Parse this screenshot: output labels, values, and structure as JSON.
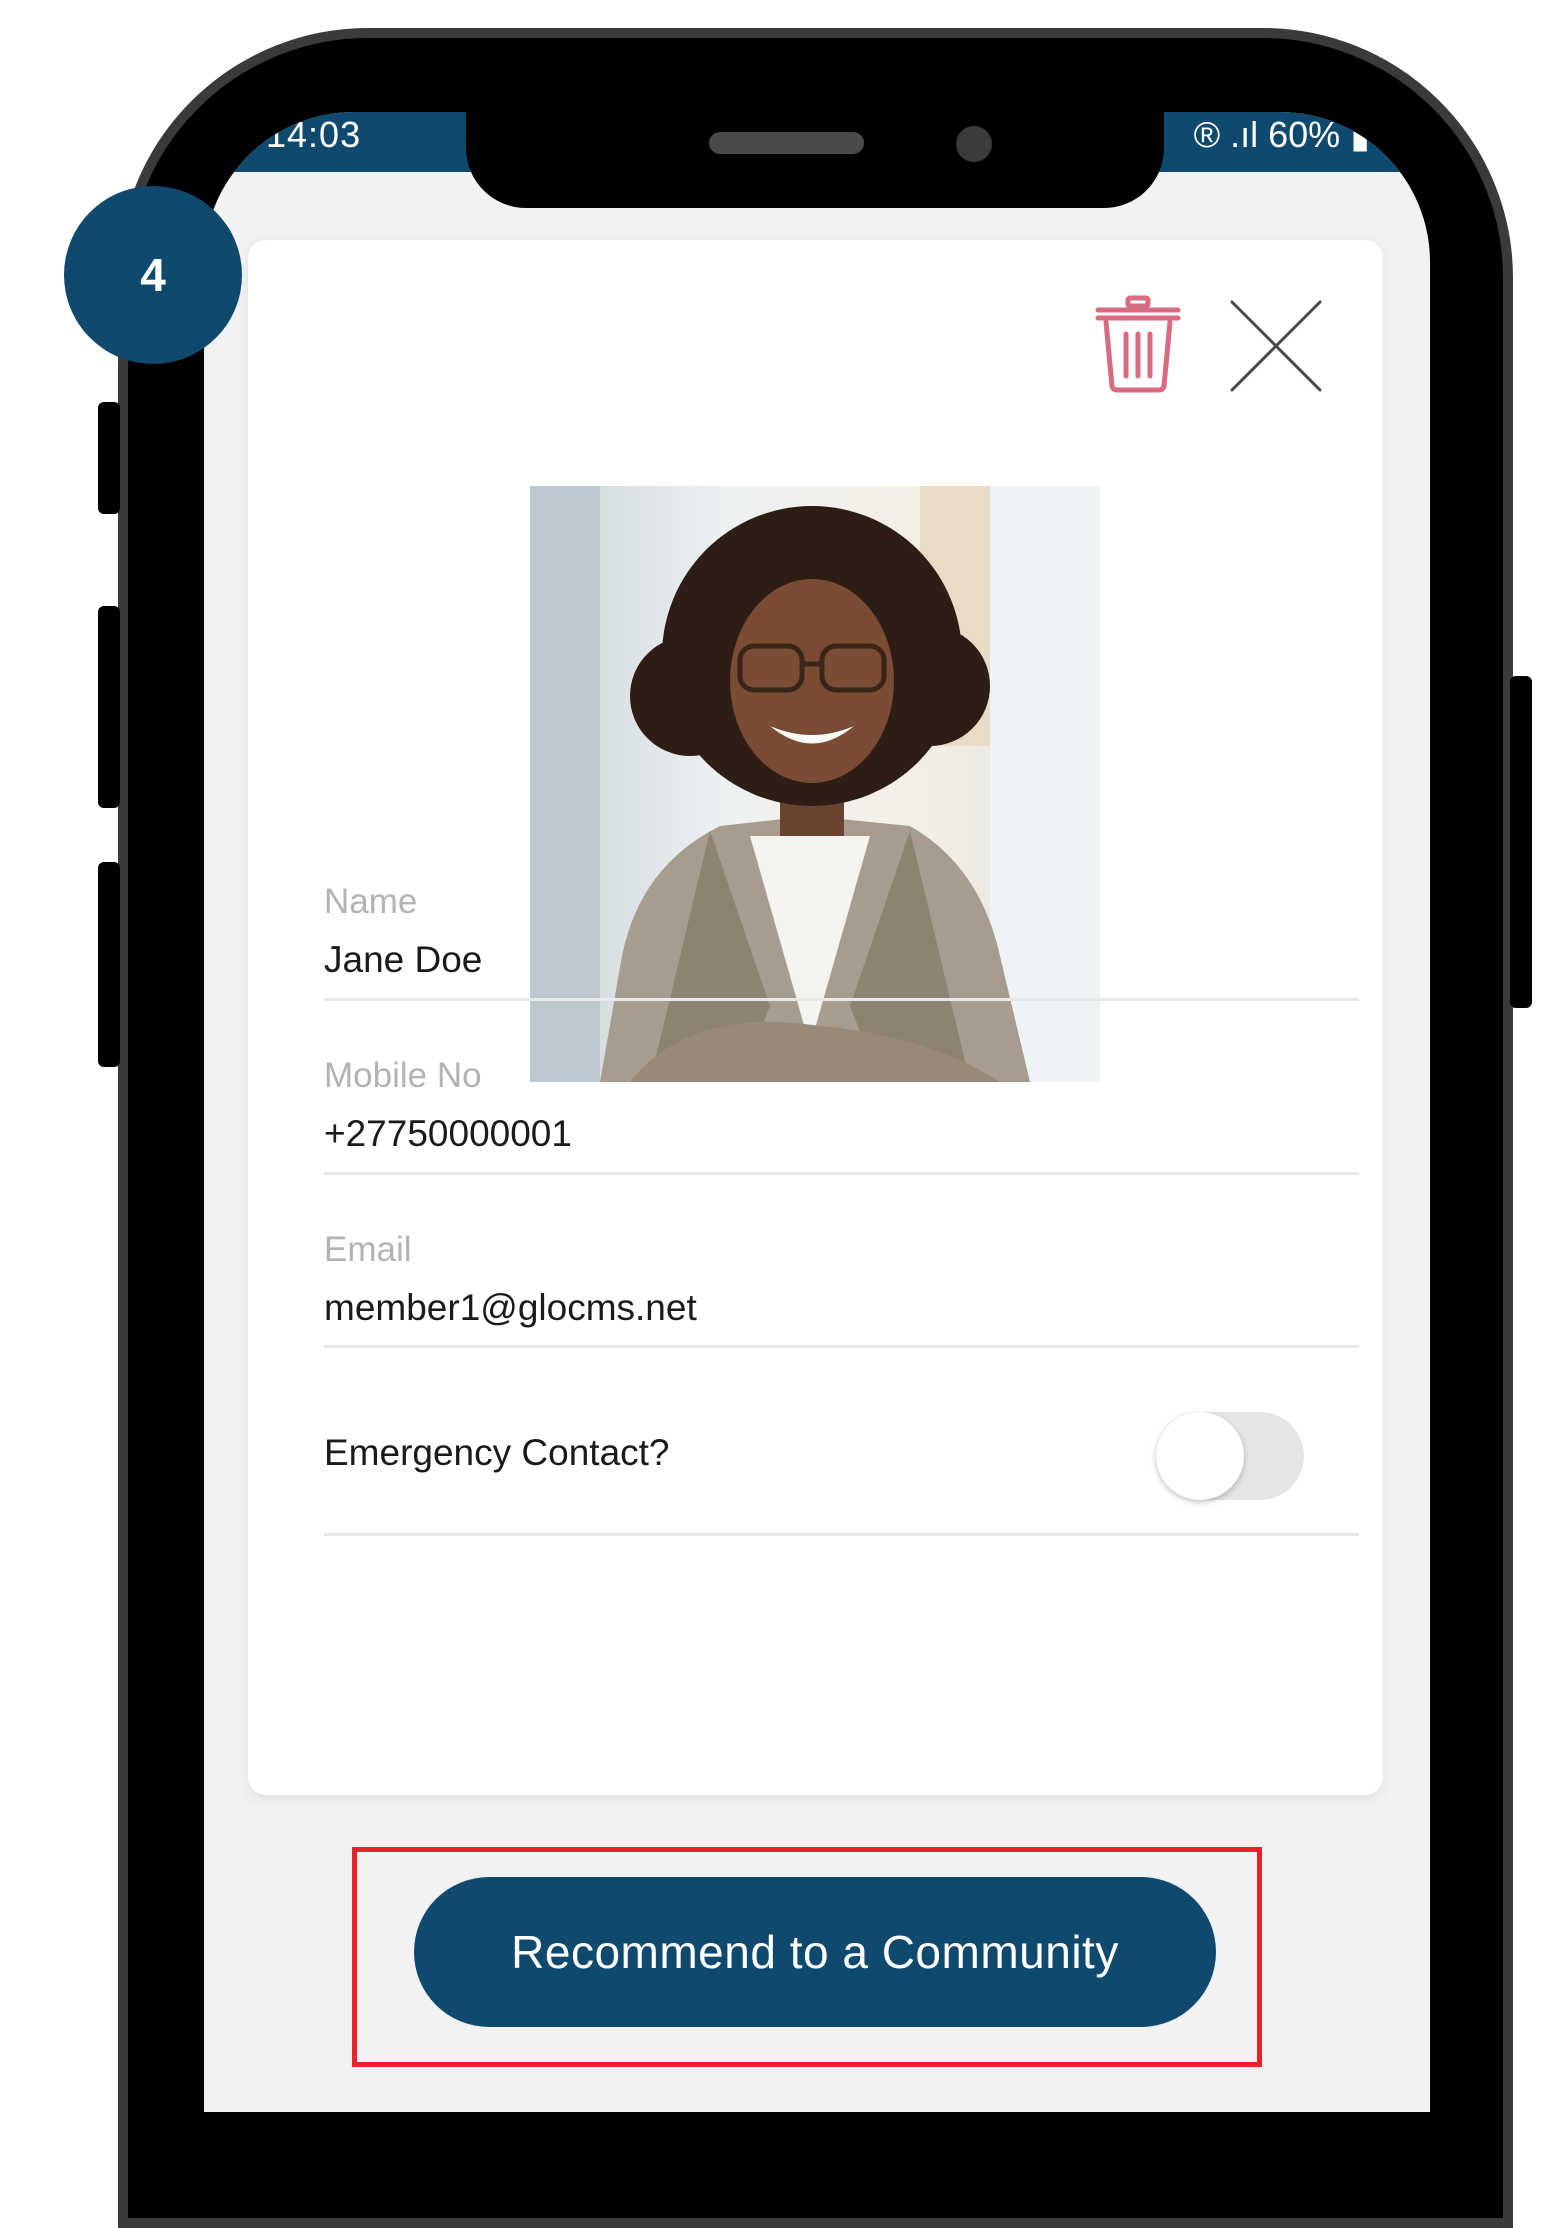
{
  "status_bar": {
    "time": "14:03",
    "signal": "® .ıl",
    "battery": "60%"
  },
  "step_badge": "4",
  "profile": {
    "delete_icon": "trash-icon",
    "close_icon": "close-icon",
    "photo_alt": "profile-photo",
    "fields": [
      {
        "label": "Name",
        "value": "Jane Doe"
      },
      {
        "label": "Mobile No",
        "value": "+27750000001"
      },
      {
        "label": "Email",
        "value": "member1@glocms.net"
      }
    ],
    "emergency_contact": {
      "label": "Emergency Contact?",
      "enabled": false
    }
  },
  "actions": {
    "recommend_label": "Recommend to a Community"
  },
  "colors": {
    "primary": "#0f4a6e",
    "danger": "#d96a80",
    "highlight": "#e8212b"
  }
}
